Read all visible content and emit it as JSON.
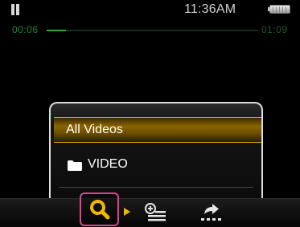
{
  "status_bar": {
    "time": "11:36AM",
    "playback_state_icon": "pause-icon",
    "battery_icon": "battery-icon"
  },
  "progress": {
    "elapsed": "00:06",
    "total": "01:09",
    "fraction": 0.09,
    "fill_color": "#2fa945"
  },
  "menu": {
    "items": [
      {
        "label": "All Videos",
        "selected": true,
        "icon": ""
      },
      {
        "label": "VIDEO",
        "selected": false,
        "icon": "folder-icon"
      }
    ],
    "highlight_color": "#d8a000"
  },
  "toolbar": {
    "buttons": [
      {
        "icon": "search-icon",
        "focused": true,
        "focus_color": "#e0458a"
      },
      {
        "icon": "add-to-playlist-icon",
        "focused": false
      },
      {
        "icon": "share-icon",
        "focused": false
      }
    ],
    "indicator_icon": "arrow-right-icon",
    "accent_color": "#f2b600"
  }
}
